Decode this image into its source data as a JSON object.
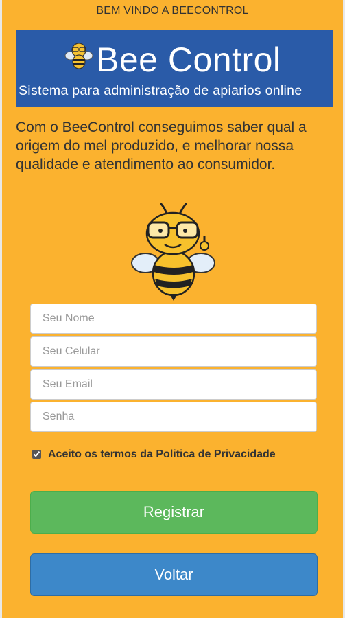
{
  "header": {
    "welcome": "BEM VINDO A BEECONTROL"
  },
  "banner": {
    "title": "Bee Control",
    "subtitle": "Sistema para administração de apiarios online",
    "logo_icon": "bee-logo-icon"
  },
  "intro": {
    "text": "Com o BeeControl conseguimos saber qual a origem do mel produzido, e melhorar nossa qualidade e atendimento ao consumidor."
  },
  "mascot": {
    "icon": "bee-mascot-icon"
  },
  "form": {
    "name_placeholder": "Seu Nome",
    "phone_placeholder": "Seu Celular",
    "email_placeholder": "Seu Email",
    "password_placeholder": "Senha",
    "name_value": "",
    "phone_value": "",
    "email_value": "",
    "password_value": "",
    "terms_checked": true,
    "terms_label": "Aceito os termos da Politica de Privacidade"
  },
  "buttons": {
    "register_label": "Registrar",
    "back_label": "Voltar"
  },
  "colors": {
    "background": "#fbb22f",
    "banner": "#2a5ba8",
    "register": "#5cb85c",
    "back": "#3d88c9"
  }
}
